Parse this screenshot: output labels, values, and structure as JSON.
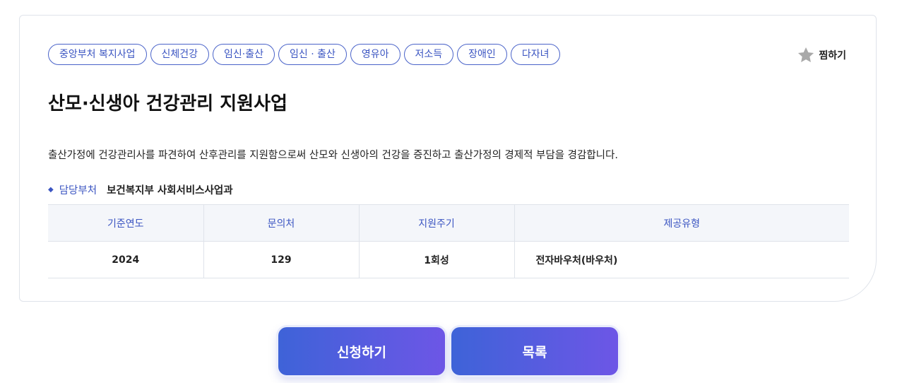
{
  "tags": [
    "중앙부처 복지사업",
    "신체건강",
    "임신·출산",
    "임신 · 출산",
    "영유아",
    "저소득",
    "장애인",
    "다자녀"
  ],
  "bookmark": {
    "label": "찜하기",
    "icon": "star-icon"
  },
  "title": "산모·신생아 건강관리 지원사업",
  "description": "출산가정에 건강관리사를 파견하여 산후관리를 지원함으로써 산모와 신생아의 건강을 증진하고 출산가정의 경제적 부담을 경감합니다.",
  "department": {
    "label": "담당부처",
    "value": "보건복지부 사회서비스사업과"
  },
  "table": {
    "headers": [
      "기준연도",
      "문의처",
      "지원주기",
      "제공유형"
    ],
    "row": [
      "2024",
      "129",
      "1회성",
      "전자바우처(바우처)"
    ]
  },
  "buttons": {
    "apply": "신청하기",
    "list": "목록"
  },
  "colors": {
    "accent": "#3b55c2",
    "button_start": "#3e63d8",
    "button_end": "#6d56e6"
  }
}
